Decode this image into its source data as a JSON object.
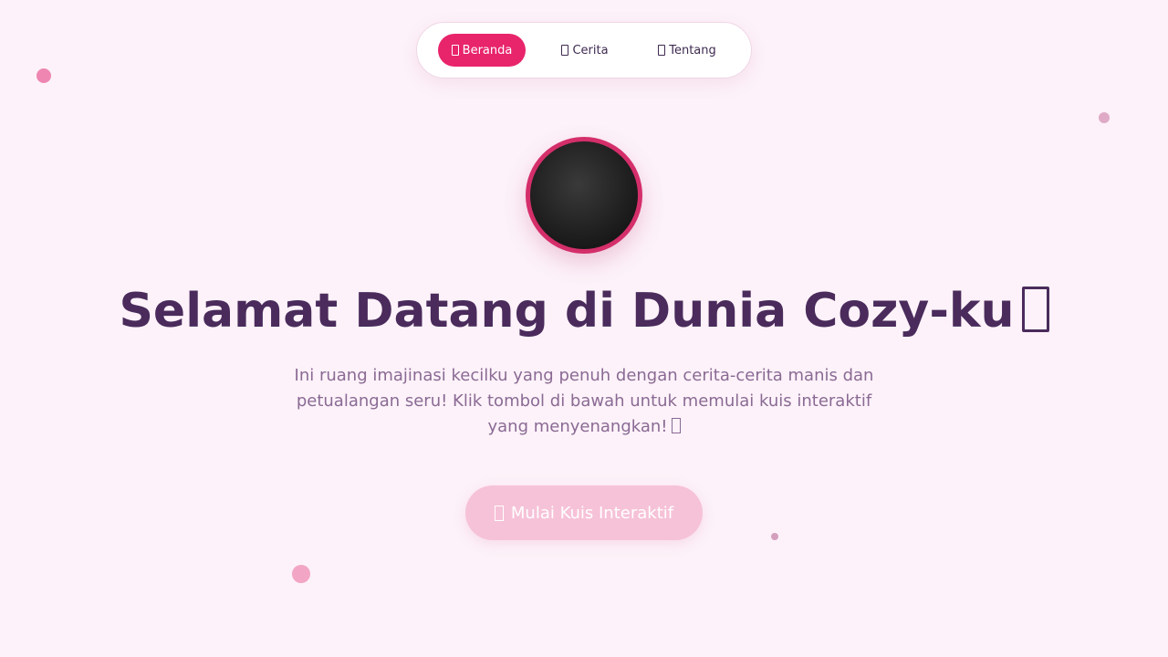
{
  "nav": {
    "items": [
      {
        "label": "Beranda",
        "icon": "home-icon",
        "active": true
      },
      {
        "label": "Cerita",
        "icon": "book-icon",
        "active": false
      },
      {
        "label": "Tentang",
        "icon": "info-icon",
        "active": false
      }
    ]
  },
  "hero": {
    "title": "Selamat Datang di Dunia Cozy-ku",
    "title_icon": "emoji-icon",
    "description": "Ini ruang imajinasi kecilku yang penuh dengan cerita-cerita manis dan petualangan seru! Klik tombol di bawah untuk memulai kuis interaktif yang menyenangkan!",
    "description_icon": "emoji-icon",
    "cta_label": "Mulai Kuis Interaktif",
    "cta_icon": "sparkle-icon"
  },
  "colors": {
    "background": "#fdf2f9",
    "accent": "#e8246b",
    "heading": "#4a2b5c",
    "body_text": "#8a6a94",
    "cta_bg": "#f6c2d7",
    "avatar_border": "#d42f6a"
  }
}
